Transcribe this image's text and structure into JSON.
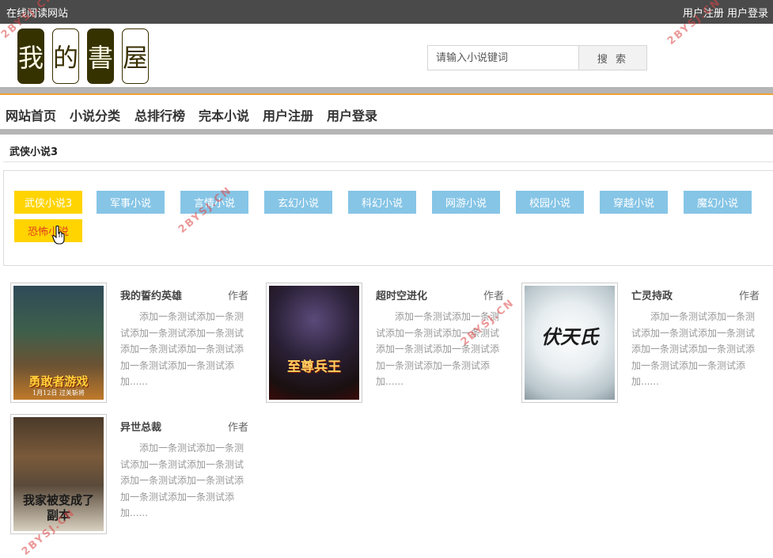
{
  "topbar": {
    "site_name": "在线阅读网站",
    "register": "用户注册",
    "login": "用户登录"
  },
  "logo": {
    "chars": [
      "我",
      "的",
      "書",
      "屋"
    ]
  },
  "search": {
    "placeholder": "请输入小说键词",
    "button": "搜 索"
  },
  "nav": {
    "items": [
      "网站首页",
      "小说分类",
      "总排行榜",
      "完本小说",
      "用户注册",
      "用户登录"
    ]
  },
  "breadcrumb": "武侠小说3",
  "categories": [
    "武侠小说3",
    "军事小说",
    "言情小说",
    "玄幻小说",
    "科幻小说",
    "网游小说",
    "校园小说",
    "穿越小说",
    "魔幻小说",
    "恐怖小说"
  ],
  "books": [
    {
      "title": "我的誓约英雄",
      "author": "作者",
      "desc": "添加一条测试添加一条测试添加一条测试添加一条测试添加一条测试添加一条测试添加一条测试添加一条测试添加......",
      "cover_text": "勇敢者游戏",
      "cover_sub": "1月12日 过关斩将"
    },
    {
      "title": "超时空进化",
      "author": "作者",
      "desc": "添加一条测试添加一条测试添加一条测试添加一条测试添加一条测试添加一条测试添加一条测试添加一条测试添加......",
      "cover_text": "至尊兵王",
      "cover_sub": ""
    },
    {
      "title": "亡灵持政",
      "author": "作者",
      "desc": "添加一条测试添加一条测试添加一条测试添加一条测试添加一条测试添加一条测试添加一条测试添加一条测试添加......",
      "cover_text": "伏天氏",
      "cover_sub": ""
    },
    {
      "title": "异世总裁",
      "author": "作者",
      "desc": "添加一条测试添加一条测试添加一条测试添加一条测试添加一条测试添加一条测试添加一条测试添加一条测试添加......",
      "cover_text": "我家被变成了副本",
      "cover_sub": ""
    }
  ],
  "watermark": "2BYSJ.CN",
  "colors": {
    "topbar": "#4a4a4a",
    "category_blue": "#86c5e6",
    "category_yellow": "#ffd400",
    "nav_accent": "#f0a030"
  }
}
